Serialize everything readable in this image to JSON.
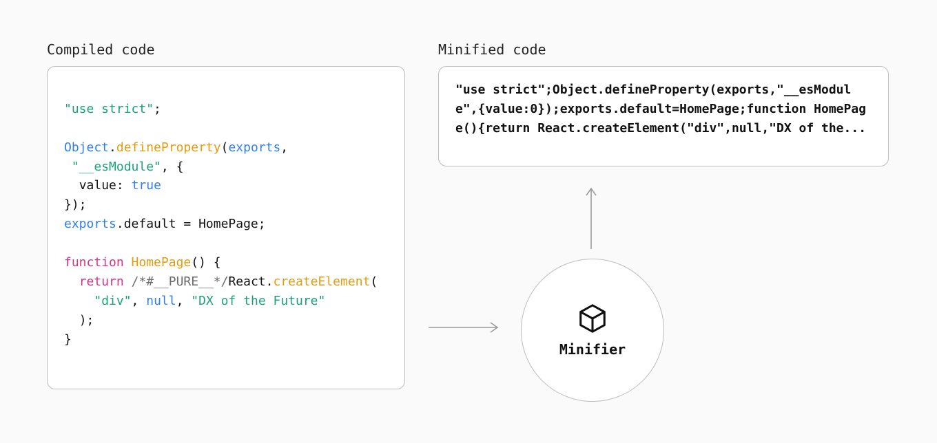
{
  "compiled": {
    "label": "Compiled code",
    "code": {
      "l1_str": "\"use strict\"",
      "l3_obj": "Object",
      "l3_fn": "defineProperty",
      "l3_arg": "exports",
      "l4_str": "\"__esModule\"",
      "l5_key": "value",
      "l5_val": "true",
      "l7_exports": "exports",
      "l7_prop": ".default = HomePage;",
      "l9_kw": "function",
      "l9_name": "HomePage",
      "l10_kw": "return",
      "l10_comment": "/*#__PURE__*/",
      "l10_react": "React",
      "l10_fn": "createElement",
      "l11_str1": "\"div\"",
      "l11_null": "null",
      "l11_str2": "\"DX of the Future\""
    }
  },
  "minified": {
    "label": "Minified code",
    "code": "\"use strict\";Object.defineProperty(exports,\"__esModule\",{value:0});exports.default=HomePage;function HomePage(){return React.createElement(\"div\",null,\"DX of the..."
  },
  "minifier": {
    "label": "Minifier"
  }
}
